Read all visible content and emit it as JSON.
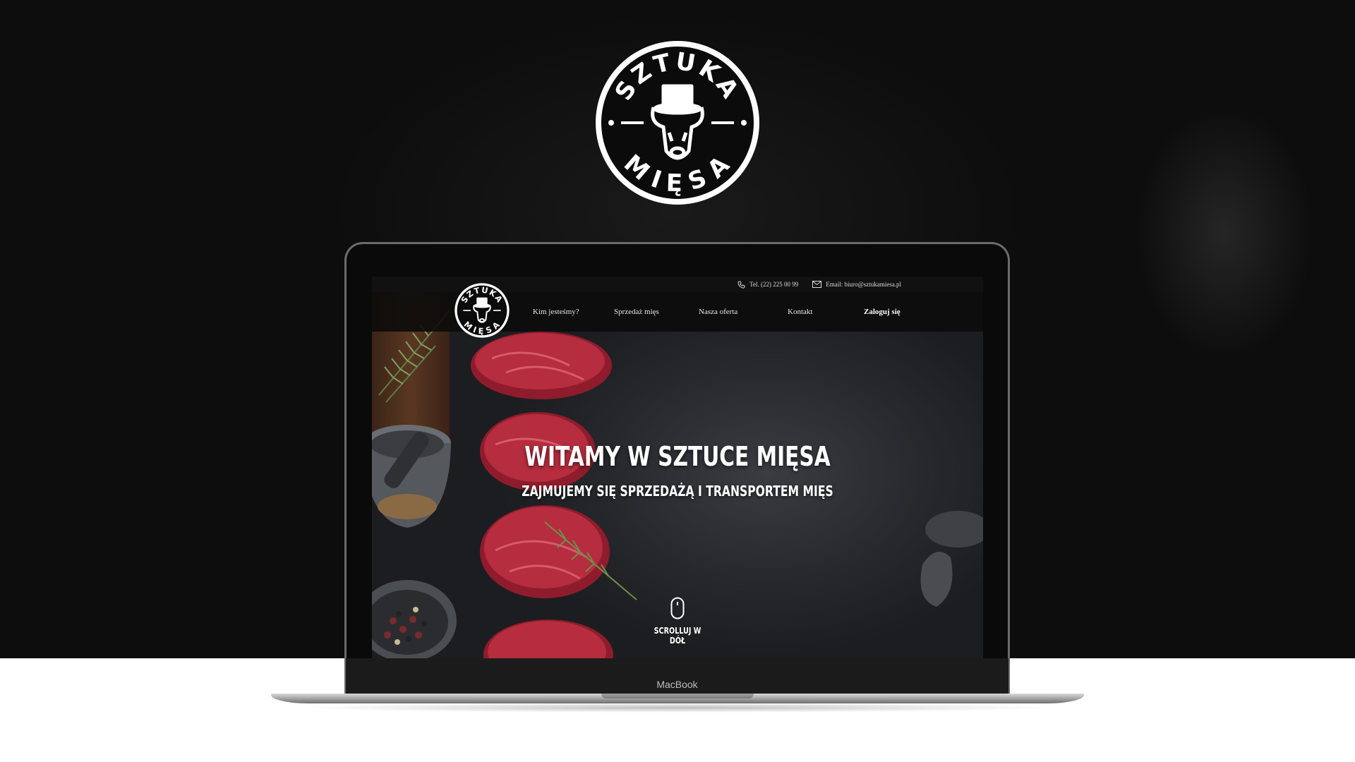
{
  "brand": {
    "name_top": "SZTUKA",
    "name_bottom": "MIĘSA"
  },
  "laptop": {
    "label": "MacBook"
  },
  "site": {
    "topbar": {
      "phone": "Tel. (22) 225 00 99",
      "email": "Email: biuro@sztukamiesa.pl",
      "phone_icon": "phone-icon",
      "email_icon": "envelope-icon"
    },
    "nav": {
      "items": [
        {
          "label": "Kim jesteśmy?"
        },
        {
          "label": "Sprzedaż mięs"
        },
        {
          "label": "Nasza oferta"
        },
        {
          "label": "Kontakt"
        },
        {
          "label": "Zaloguj się"
        }
      ]
    },
    "hero": {
      "title": "WITAMY W SZTUCE MIĘSA",
      "subtitle": "ZAJMUJEMY SIĘ SPRZEDAŻĄ I TRANSPORTEM MIĘS",
      "scroll_label": "SCROLLUJ W DÓŁ",
      "scroll_icon": "mouse-icon"
    }
  },
  "colors": {
    "background": "#0b0b0b",
    "meat": "#b3263a",
    "text": "#ffffff"
  }
}
